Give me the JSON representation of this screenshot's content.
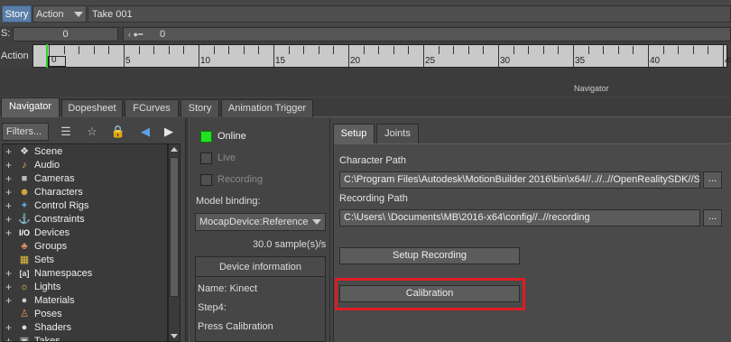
{
  "story_bar": {
    "story_label": "Story",
    "action_label": "Action",
    "take_label": "Take 001"
  },
  "s_row": {
    "label": "S:",
    "value": "0",
    "value2": "0"
  },
  "timeline": {
    "label": "Action",
    "current_frame": "0",
    "ticks": [
      "5",
      "10",
      "15",
      "20",
      "25",
      "30",
      "35",
      "40",
      "45"
    ]
  },
  "navigator_title": "Navigator",
  "tabs": [
    "Navigator",
    "Dopesheet",
    "FCurves",
    "Story",
    "Animation Trigger"
  ],
  "navigator_toolbar": {
    "filters_label": "Filters..."
  },
  "tree": [
    {
      "label": "Scene",
      "icon": "scene-icon",
      "expandable": true
    },
    {
      "label": "Audio",
      "icon": "audio-icon",
      "expandable": true
    },
    {
      "label": "Cameras",
      "icon": "cameras-icon",
      "expandable": true
    },
    {
      "label": "Characters",
      "icon": "characters-icon",
      "expandable": true
    },
    {
      "label": "Control Rigs",
      "icon": "control-rigs-icon",
      "expandable": true
    },
    {
      "label": "Constraints",
      "icon": "constraints-icon",
      "expandable": true
    },
    {
      "label": "Devices",
      "icon": "devices-icon",
      "expandable": true
    },
    {
      "label": "Groups",
      "icon": "groups-icon",
      "expandable": false
    },
    {
      "label": "Sets",
      "icon": "sets-icon",
      "expandable": false
    },
    {
      "label": "Namespaces",
      "icon": "namespaces-icon",
      "expandable": true
    },
    {
      "label": "Lights",
      "icon": "lights-icon",
      "expandable": true
    },
    {
      "label": "Materials",
      "icon": "materials-icon",
      "expandable": true
    },
    {
      "label": "Poses",
      "icon": "poses-icon",
      "expandable": false
    },
    {
      "label": "Shaders",
      "icon": "shaders-icon",
      "expandable": true
    },
    {
      "label": "Takes",
      "icon": "takes-icon",
      "expandable": true
    }
  ],
  "device_status": {
    "online_label": "Online",
    "live_label": "Live",
    "recording_label": "Recording",
    "online_checked": true,
    "model_binding_label": "Model binding:",
    "model_binding_value": "MocapDevice:Reference",
    "sample_rate": "30.0 sample(s)/s",
    "device_info_header": "Device information",
    "device_name": "Name: Kinect",
    "step": "Step4:",
    "instruction": "Press Calibration"
  },
  "setup_tabs": [
    "Setup",
    "Joints"
  ],
  "setup": {
    "character_path_label": "Character Path",
    "character_path_value": "C:\\Program Files\\Autodesk\\MotionBuilder 2016\\bin\\x64//..//..//OpenRealitySDK//Sc",
    "recording_path_label": "Recording Path",
    "recording_path_value": "C:\\Users\\        \\Documents\\MB\\2016-x64\\config//..//recording",
    "browse_label": "...",
    "setup_recording_label": "Setup Recording",
    "calibration_label": "Calibration"
  },
  "colors": {
    "accent_story": "#5a7ea8",
    "online_green": "#22e022",
    "highlight_red": "#e01b24",
    "timeline_cursor": "#2ad42a"
  }
}
